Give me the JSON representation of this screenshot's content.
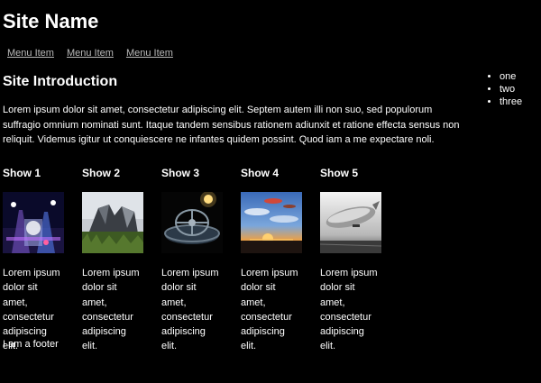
{
  "site": {
    "name": "Site Name"
  },
  "menu": {
    "items": [
      "Menu Item",
      "Menu Item",
      "Menu Item"
    ]
  },
  "side_list": {
    "items": [
      "one",
      "two",
      "three"
    ]
  },
  "intro": {
    "title": "Site Introduction",
    "text": "Lorem ipsum dolor sit amet, consectetur adipiscing elit. Septem autem illi non suo, sed populorum suffragio omnium nominati sunt. Itaque tandem sensibus rationem adiunxit et ratione effecta sensus non reliquit. Videmus igitur ut conquiescere ne infantes quidem possint. Quod iam a me expectare noli."
  },
  "shows": [
    {
      "title": "Show 1",
      "text": "Lorem ipsum dolor sit amet, consectetur adipiscing elit.",
      "image": "concert-stage-lights"
    },
    {
      "title": "Show 2",
      "text": "Lorem ipsum dolor sit amet, consectetur adipiscing elit.",
      "image": "modern-building-on-grass"
    },
    {
      "title": "Show 3",
      "text": "Lorem ipsum dolor sit amet, consectetur adipiscing elit.",
      "image": "gyroscope-sculpture"
    },
    {
      "title": "Show 4",
      "text": "Lorem ipsum dolor sit amet, consectetur adipiscing elit.",
      "image": "sunset-with-airships"
    },
    {
      "title": "Show 5",
      "text": "Lorem ipsum dolor sit amet, consectetur adipiscing elit.",
      "image": "zeppelin-black-white"
    }
  ],
  "footer": {
    "text": "I am a footer"
  },
  "colors": {
    "background": "#000000",
    "text": "#ffffff",
    "link": "#bbbbbb"
  }
}
